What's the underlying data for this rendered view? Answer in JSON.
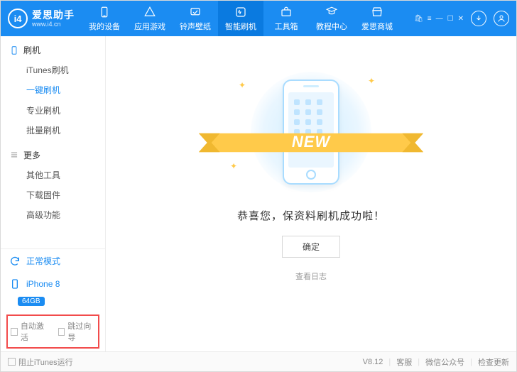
{
  "brand": {
    "badge": "i4",
    "name": "爱思助手",
    "url": "www.i4.cn"
  },
  "nav_tabs": [
    {
      "id": "device",
      "label": "我的设备",
      "icon": "device-icon"
    },
    {
      "id": "games",
      "label": "应用游戏",
      "icon": "apps-icon"
    },
    {
      "id": "ring",
      "label": "铃声壁纸",
      "icon": "ringtone-icon"
    },
    {
      "id": "flash",
      "label": "智能刷机",
      "icon": "flash-icon",
      "active": true
    },
    {
      "id": "toolbox",
      "label": "工具箱",
      "icon": "toolbox-icon"
    },
    {
      "id": "tutorial",
      "label": "教程中心",
      "icon": "tutorial-icon"
    },
    {
      "id": "store",
      "label": "爱思商城",
      "icon": "store-icon"
    }
  ],
  "sidebar": {
    "section_flash": {
      "title": "刷机",
      "items": [
        {
          "label": "iTunes刷机"
        },
        {
          "label": "一键刷机",
          "active": true
        },
        {
          "label": "专业刷机"
        },
        {
          "label": "批量刷机"
        }
      ]
    },
    "section_more": {
      "title": "更多",
      "items": [
        {
          "label": "其他工具"
        },
        {
          "label": "下载固件"
        },
        {
          "label": "高级功能"
        }
      ]
    },
    "mode": {
      "label": "正常模式"
    },
    "device": {
      "name": "iPhone 8",
      "capacity": "64GB"
    },
    "checks": {
      "auto_activate": "自动激活",
      "skip_guide": "跳过向导"
    }
  },
  "content": {
    "ribbon": "NEW",
    "message": "恭喜您，保资料刷机成功啦！",
    "ok": "确定",
    "log": "查看日志"
  },
  "footer": {
    "block_itunes": "阻止iTunes运行",
    "version": "V8.12",
    "support": "客服",
    "wechat": "微信公众号",
    "update": "检查更新"
  }
}
